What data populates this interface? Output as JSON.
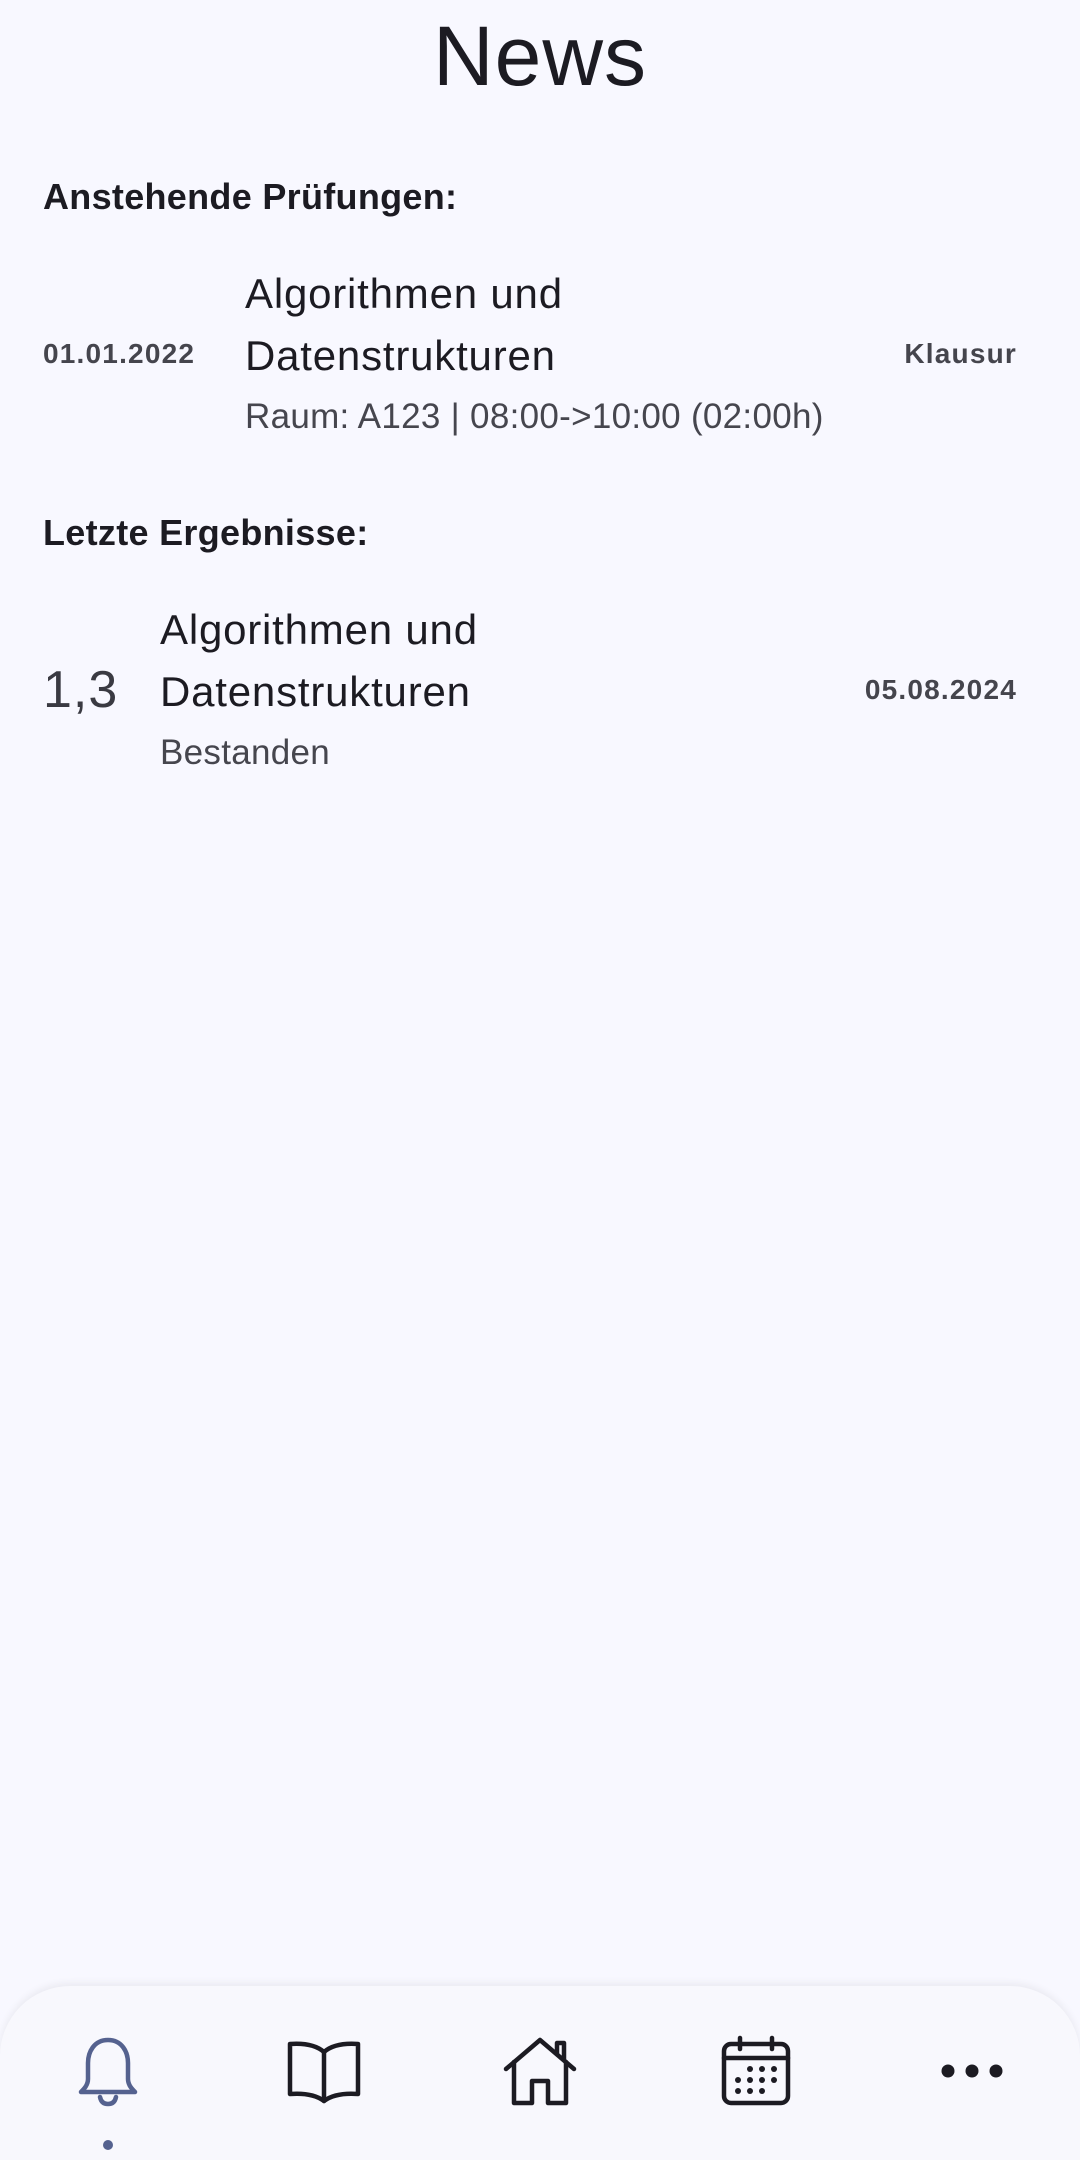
{
  "header": {
    "title": "News"
  },
  "upcoming": {
    "heading": "Anstehende Prüfungen:",
    "items": [
      {
        "date": "01.01.2022",
        "title_line1": "Algorithmen und",
        "title_line2": "Datenstrukturen",
        "details": "Raum: A123 | 08:00->10:00 (02:00h)",
        "type": "Klausur"
      }
    ]
  },
  "results": {
    "heading": "Letzte Ergebnisse:",
    "items": [
      {
        "grade": "1,3",
        "title_line1": "Algorithmen und",
        "title_line2": "Datenstrukturen",
        "status": "Bestanden",
        "date": "05.08.2024"
      }
    ]
  },
  "bottom_nav": {
    "active_index": 0,
    "items": [
      {
        "icon": "bell-icon"
      },
      {
        "icon": "book-icon"
      },
      {
        "icon": "home-icon"
      },
      {
        "icon": "calendar-icon"
      },
      {
        "icon": "more-horizontal-icon"
      }
    ],
    "active_color": "#55628f",
    "inactive_color": "#1c1b22"
  }
}
